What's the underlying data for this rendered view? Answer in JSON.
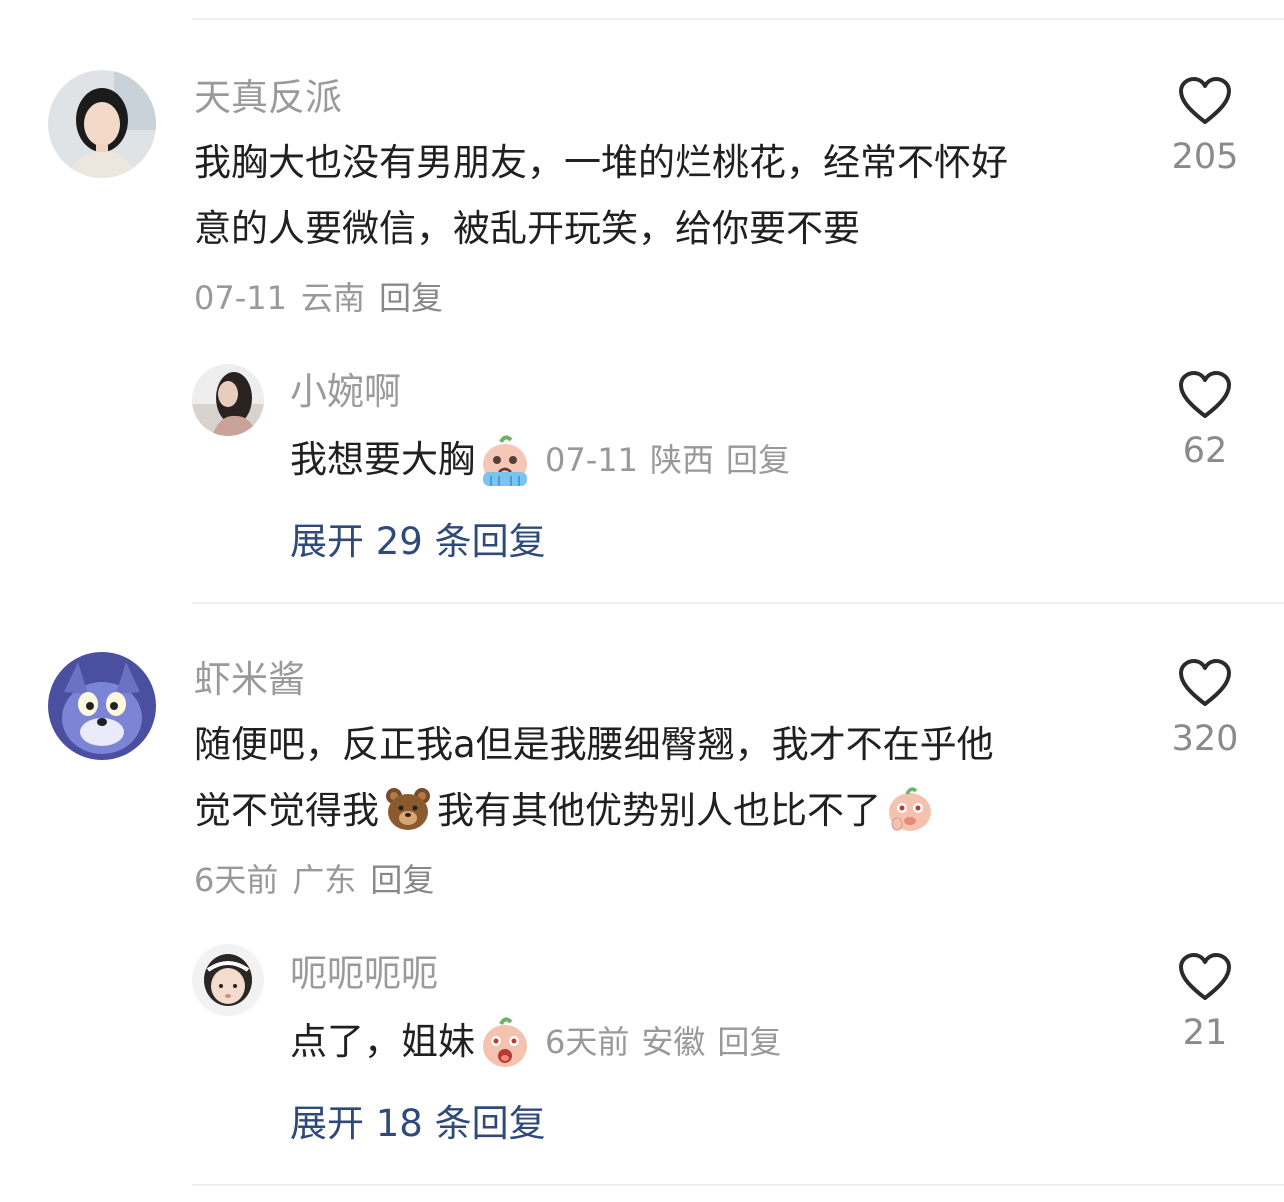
{
  "comments": [
    {
      "username": "天真反派",
      "text_line1": "我胸大也没有男朋友，一堆的烂桃花，经常不怀好",
      "text_line2": "意的人要微信，被乱开玩笑，给你要不要",
      "date": "07-11",
      "location": "云南",
      "reply_label": "回复",
      "likes": "205",
      "sub_reply": {
        "username": "小婉啊",
        "text": "我想要大胸",
        "emoji": "crying-emoji",
        "date": "07-11",
        "location": "陕西",
        "reply_label": "回复",
        "likes": "62"
      },
      "expand_label": "展开 29 条回复"
    },
    {
      "username": "虾米酱",
      "text_line1": "随便吧，反正我a但是我腰细臀翘，我才不在乎他",
      "text_line2_a": "觉不觉得我",
      "text_line2_b": "我有其他优势别人也比不了",
      "emoji_a": "bear-emoji",
      "emoji_b": "smug-emoji",
      "date": "6天前",
      "location": "广东",
      "reply_label": "回复",
      "likes": "320",
      "sub_reply": {
        "username": "呃呃呃呃",
        "text": "点了，姐妹",
        "emoji": "shocked-emoji",
        "date": "6天前",
        "location": "安徽",
        "reply_label": "回复",
        "likes": "21"
      },
      "expand_label": "展开 18 条回复"
    }
  ],
  "colors": {
    "username": "#9a9a9a",
    "text": "#202020",
    "meta": "#999999",
    "expand_link": "#2f4a7a",
    "divider": "#efefef"
  }
}
